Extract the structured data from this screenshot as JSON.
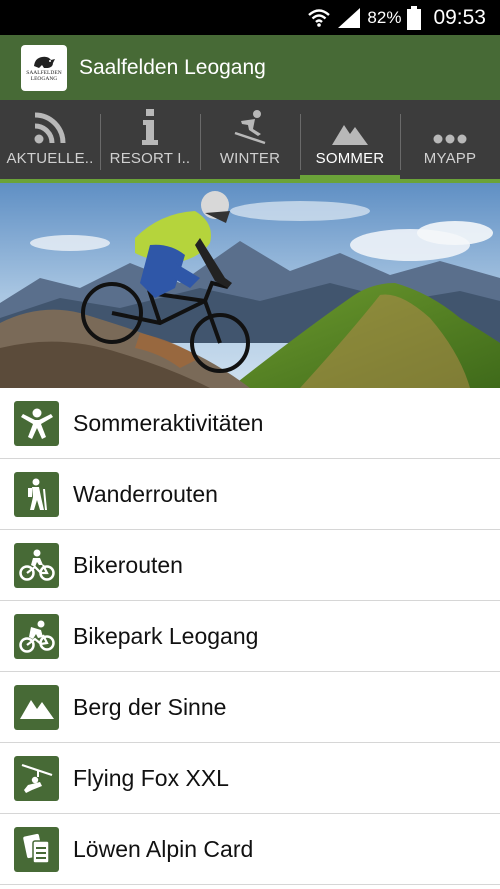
{
  "status_bar": {
    "battery_percent": "82%",
    "time": "09:53",
    "icons": [
      "wifi-icon",
      "signal-icon",
      "battery-icon"
    ]
  },
  "app_bar": {
    "title": "Saalfelden Leogang",
    "logo_text_line1": "SAALFELDEN",
    "logo_text_line2": "LEOGANG"
  },
  "tabs": [
    {
      "label": "AKTUELLE..",
      "icon": "rss-icon",
      "active": false
    },
    {
      "label": "RESORT I..",
      "icon": "info-icon",
      "active": false
    },
    {
      "label": "WINTER",
      "icon": "skier-icon",
      "active": false
    },
    {
      "label": "SOMMER",
      "icon": "mountain-icon",
      "active": true
    },
    {
      "label": "MYAPP",
      "icon": "more-icon",
      "active": false
    }
  ],
  "menu": [
    {
      "label": "Sommeraktivitäten",
      "icon": "person-jump-icon"
    },
    {
      "label": "Wanderrouten",
      "icon": "hiker-icon"
    },
    {
      "label": "Bikerouten",
      "icon": "cyclist-icon"
    },
    {
      "label": "Bikepark Leogang",
      "icon": "mountain-bike-icon"
    },
    {
      "label": "Berg der Sinne",
      "icon": "mountain-icon"
    },
    {
      "label": "Flying Fox XXL",
      "icon": "zipline-icon"
    },
    {
      "label": "Löwen Alpin Card",
      "icon": "cards-icon"
    }
  ],
  "colors": {
    "app_bar": "#476a36",
    "tab_bar": "#3c3c3c",
    "tab_indicator": "#6ba339",
    "icon_tile": "#476a36"
  }
}
